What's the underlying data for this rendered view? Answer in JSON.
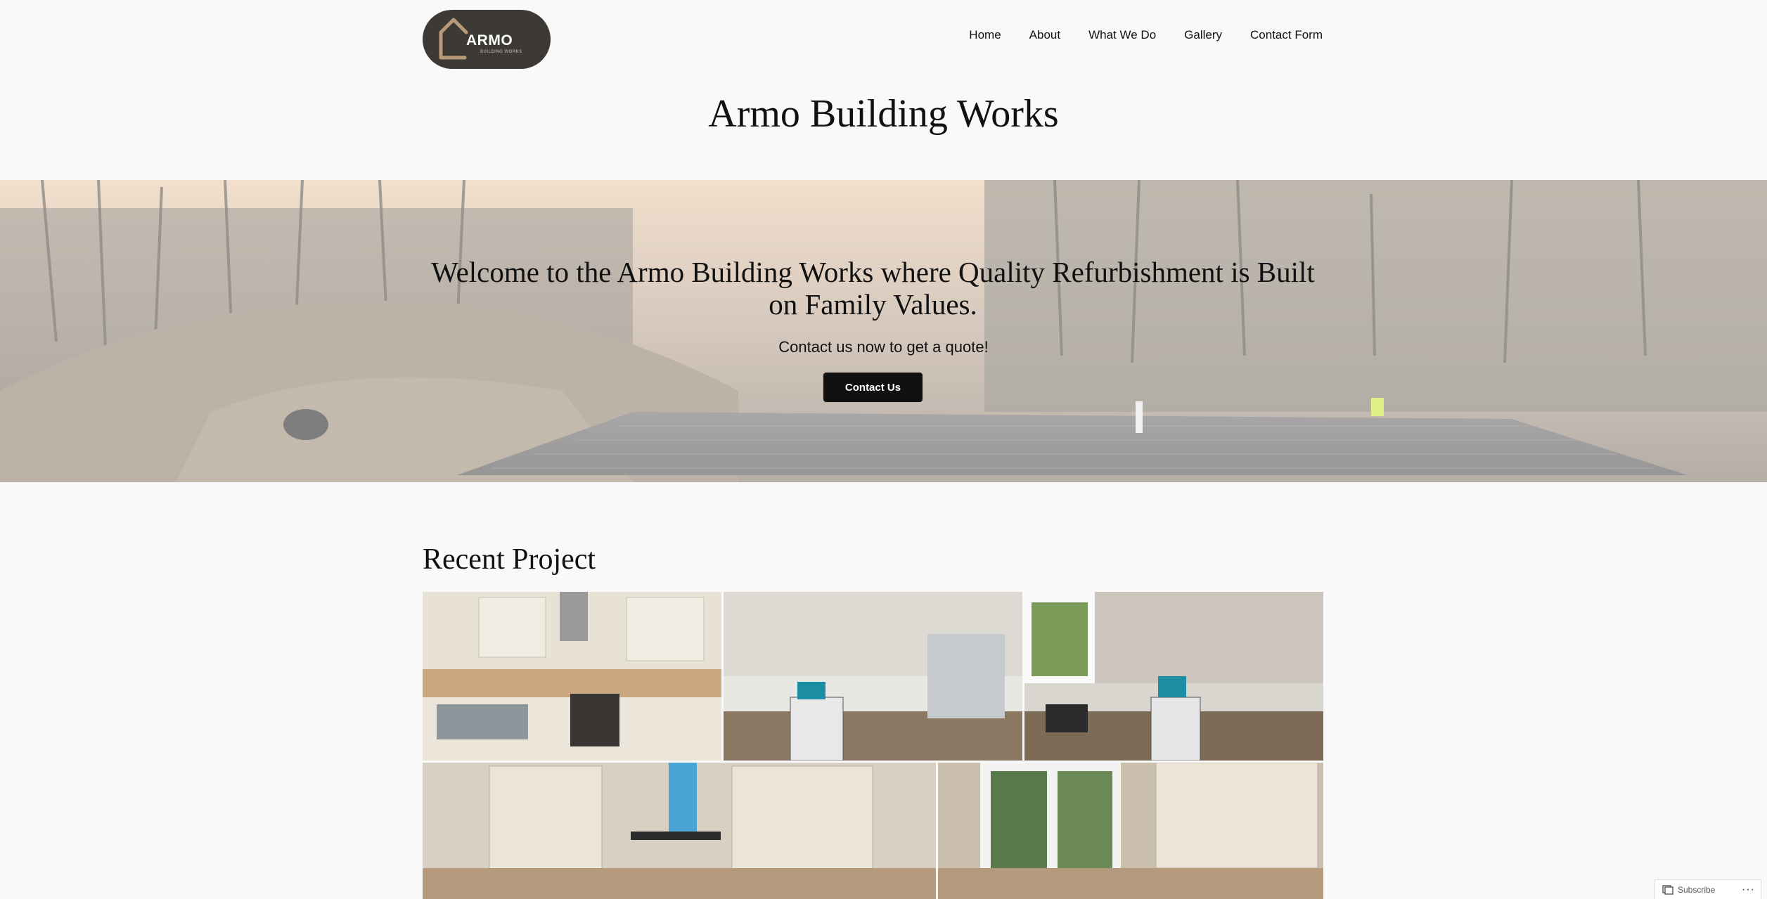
{
  "header": {
    "logo_main": "ARMO",
    "logo_sub": "BUILDING WORKS",
    "site_title": "Armo Building Works",
    "nav": [
      "Home",
      "About",
      "What We Do",
      "Gallery",
      "Contact Form"
    ]
  },
  "hero": {
    "heading": "Welcome to the Armo Building Works where Quality Refurbishment is Built on Family Values.",
    "subheading": "Contact us now to get a quote!",
    "button_label": "Contact Us"
  },
  "recent": {
    "title": "Recent Project"
  },
  "subscribe": {
    "label": "Subscribe",
    "more": "···"
  },
  "colors": {
    "logo_bg": "#3d3935",
    "button_bg": "#111111",
    "page_bg": "#f9f9f9"
  }
}
